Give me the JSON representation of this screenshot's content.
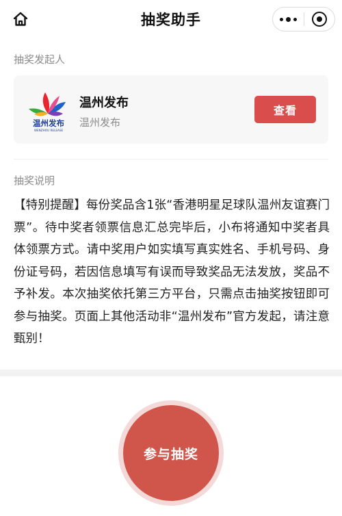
{
  "nav": {
    "title": "抽奖助手",
    "home_icon": "home-icon",
    "more_icon": "more-dots-icon",
    "close_icon": "mini-program-close-icon"
  },
  "organizer": {
    "section_label": "抽奖发起人",
    "name": "温州发布",
    "subtitle": "温州发布",
    "view_button": "查看",
    "logo": {
      "icon": "wenzhou-fabu-logo",
      "text": "温州发布",
      "tagline": "WENZHOU RELEASE"
    }
  },
  "description": {
    "section_label": "抽奖说明",
    "text": "【特别提醒】每份奖品含1张“香港明星足球队温州友谊赛门票”。待中奖者领票信息汇总完毕后，小布将通知中奖者具体领票方式。请中奖用户如实填写真实姓名、手机号码、身份证号码，若因信息填写有误而导致奖品无法发放，奖品不予补发。本次抽奖依托第三方平台，只需点击抽奖按钮即可参与抽奖。页面上其他活动非“温州发布”官方发起，请注意甄别！"
  },
  "action": {
    "join_button": "参与抽奖"
  },
  "colors": {
    "accent": "#d94d4d",
    "join_button": "#d0554a",
    "card_bg": "#f7f7f7",
    "muted_text": "#8c8c8c"
  }
}
